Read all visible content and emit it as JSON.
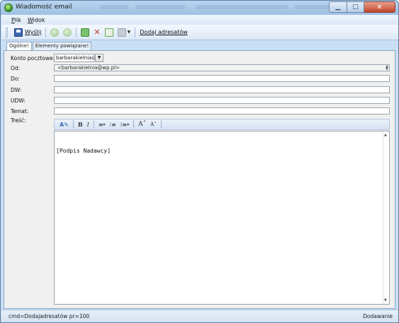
{
  "window": {
    "title": "Wiadomość email"
  },
  "menu": [
    {
      "label": "Plik",
      "underline": "P",
      "rest": "lik"
    },
    {
      "label": "Widok",
      "underline": "W",
      "rest": "idok"
    }
  ],
  "toolbar": {
    "send_label": "Wyślij",
    "add_recipients_label": "Dodaj adresatów"
  },
  "tabs": [
    {
      "label": "Ogólne!",
      "active": true
    },
    {
      "label": "Elementy powiązane!",
      "active": false
    }
  ],
  "form": {
    "account_label": "Konto pocztowe:",
    "account_value": "barbarakielnia@wp.pl",
    "from_label": "Od:",
    "from_value": "<barbarakielnia@wp.pl>",
    "to_label": "Do:",
    "to_value": "",
    "cc_label": "DW:",
    "cc_value": "",
    "bcc_label": "UDW:",
    "bcc_value": "",
    "subject_label": "Temat:",
    "subject_value": "",
    "body_label": "Treść:"
  },
  "editor": {
    "toolbar": [
      "font-color",
      "bold",
      "italic",
      "align",
      "list-numbered",
      "list-bullet",
      "grow-font",
      "shrink-font"
    ],
    "body_text": "[Podpis Nadawcy]"
  },
  "status": {
    "left": "cmd=Dodajadresatów pr=100",
    "right": "Dodawanie"
  },
  "colors": {
    "window_frame": "#c9dff3",
    "close_button": "#c1442b"
  }
}
